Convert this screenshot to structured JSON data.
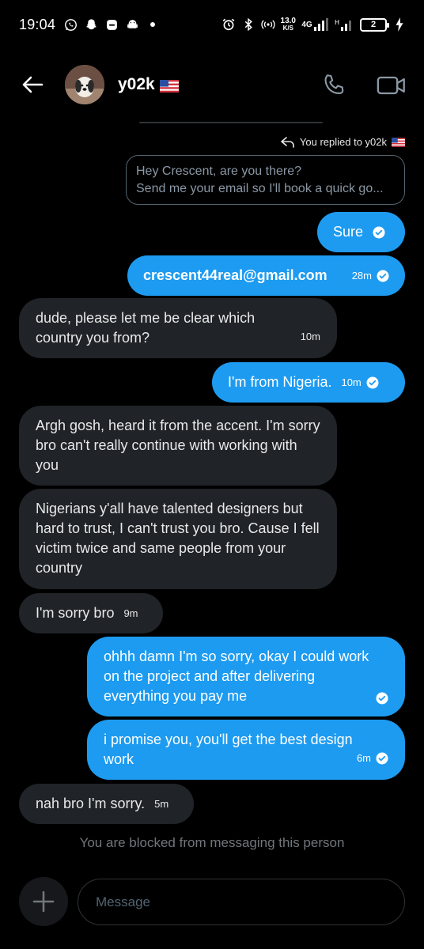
{
  "status_bar": {
    "time": "19:04",
    "net_speed_value": "13.0",
    "net_speed_unit": "K/S",
    "network_type": "4G",
    "battery_level": "2",
    "left_icons": [
      "whatsapp-icon",
      "snapchat-icon",
      "message-icon",
      "android-icon",
      "dot-icon"
    ],
    "right_icons": [
      "alarm-icon",
      "bluetooth-icon",
      "hotspot-icon",
      "signal-icon",
      "battery-icon",
      "charging-icon"
    ]
  },
  "header": {
    "contact_name": "y02k",
    "flag": "us-flag-icon",
    "icons": [
      "back-arrow-icon",
      "phone-icon",
      "video-camera-icon"
    ]
  },
  "reply_context": {
    "label": "You replied to y02k",
    "quoted_line_1": "Hey Crescent, are you there?",
    "quoted_line_2": "Send me your email so I'll book a quick go..."
  },
  "messages": [
    {
      "dir": "out",
      "text": "Sure",
      "time": ""
    },
    {
      "dir": "out",
      "text": "crescent44real@gmail.com",
      "time": "28m"
    },
    {
      "dir": "in",
      "text": "dude, please let me be clear which country you from?",
      "time": "10m"
    },
    {
      "dir": "out",
      "text": "I'm from Nigeria.",
      "time": "10m"
    },
    {
      "dir": "in",
      "text": "Argh gosh, heard it from the accent. I'm sorry bro can't really continue with working with you",
      "time": ""
    },
    {
      "dir": "in",
      "text": "Nigerians y'all have talented designers but hard to trust, I can't trust you bro. Cause I fell victim twice and same people from your country",
      "time": ""
    },
    {
      "dir": "in",
      "text": "I'm sorry bro",
      "time": "9m"
    },
    {
      "dir": "out",
      "text": "ohhh damn I'm so sorry, okay I could work on the project and after delivering everything you pay me",
      "time": ""
    },
    {
      "dir": "out",
      "text": "i promise you, you'll get the best design work",
      "time": "6m"
    },
    {
      "dir": "in",
      "text": "nah bro I'm sorry.",
      "time": "5m"
    }
  ],
  "blocked_notice": "You are blocked from messaging this person",
  "composer": {
    "placeholder": "Message"
  },
  "colors": {
    "background": "#000000",
    "outgoing_bubble": "#1d9bf0",
    "incoming_bubble": "#202327",
    "muted_text": "#71767b"
  }
}
